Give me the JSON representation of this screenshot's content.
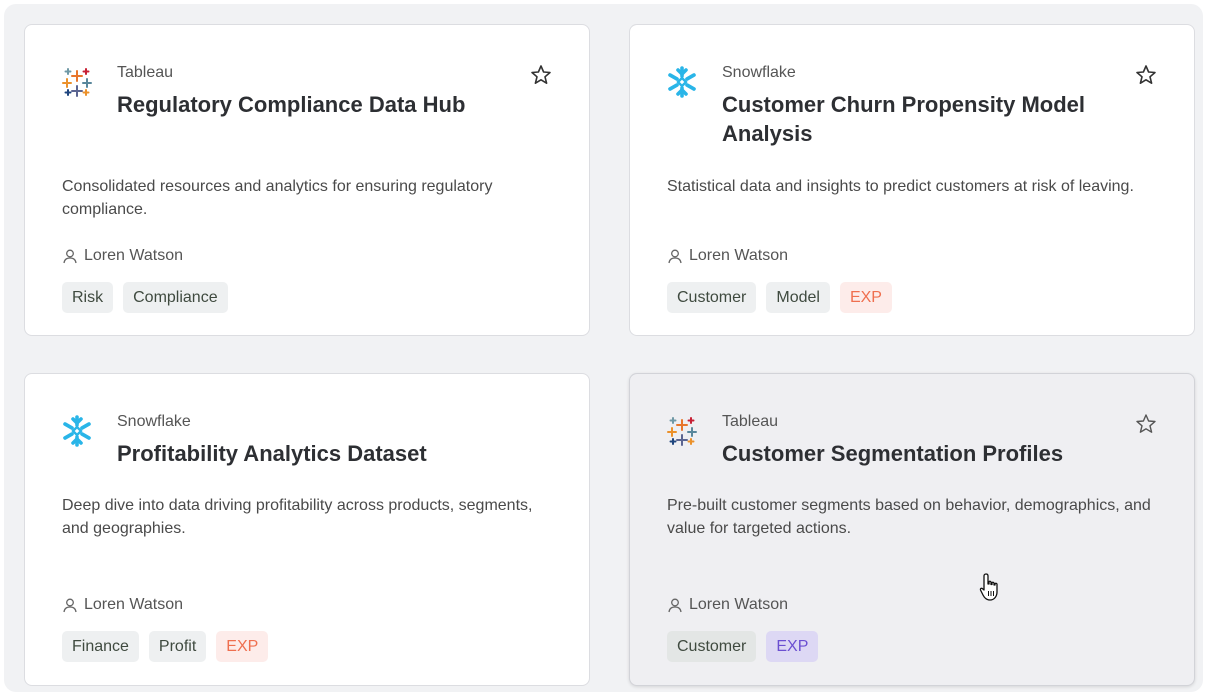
{
  "cards": [
    {
      "source": "Tableau",
      "logo_icon": "tableau-logo-icon",
      "title": "Regulatory Compliance Data Hub",
      "description": "Consolidated resources and analytics for ensuring regulatory compliance.",
      "owner": "Loren Watson",
      "tags": [
        "Risk",
        "Compliance"
      ]
    },
    {
      "source": "Snowflake",
      "logo_icon": "snowflake-logo-icon",
      "title": "Customer Churn Propensity Model Analysis",
      "description": "Statistical data and insights to predict customers at risk of leaving.",
      "owner": "Loren Watson",
      "tags": [
        "Customer",
        "Model",
        "EXP"
      ]
    },
    {
      "source": "Snowflake",
      "logo_icon": "snowflake-logo-icon",
      "title": "Profitability Analytics Dataset",
      "description": "Deep dive into data driving profitability across products, segments, and geographies.",
      "owner": "Loren Watson",
      "tags": [
        "Finance",
        "Profit",
        "EXP"
      ]
    },
    {
      "source": "Tableau",
      "logo_icon": "tableau-logo-icon",
      "title": "Customer Segmentation Profiles",
      "description": "Pre-built customer segments based on behavior, demographics, and value for targeted actions.",
      "owner": "Loren Watson",
      "tags": [
        "Customer",
        "EXP"
      ]
    }
  ],
  "colors": {
    "exp_tag_text": "#ef6f4f",
    "exp_tag_bg": "#fdecea",
    "exp_tag_hover_text": "#6b4fd1",
    "snowflake_blue": "#29b5e8"
  }
}
